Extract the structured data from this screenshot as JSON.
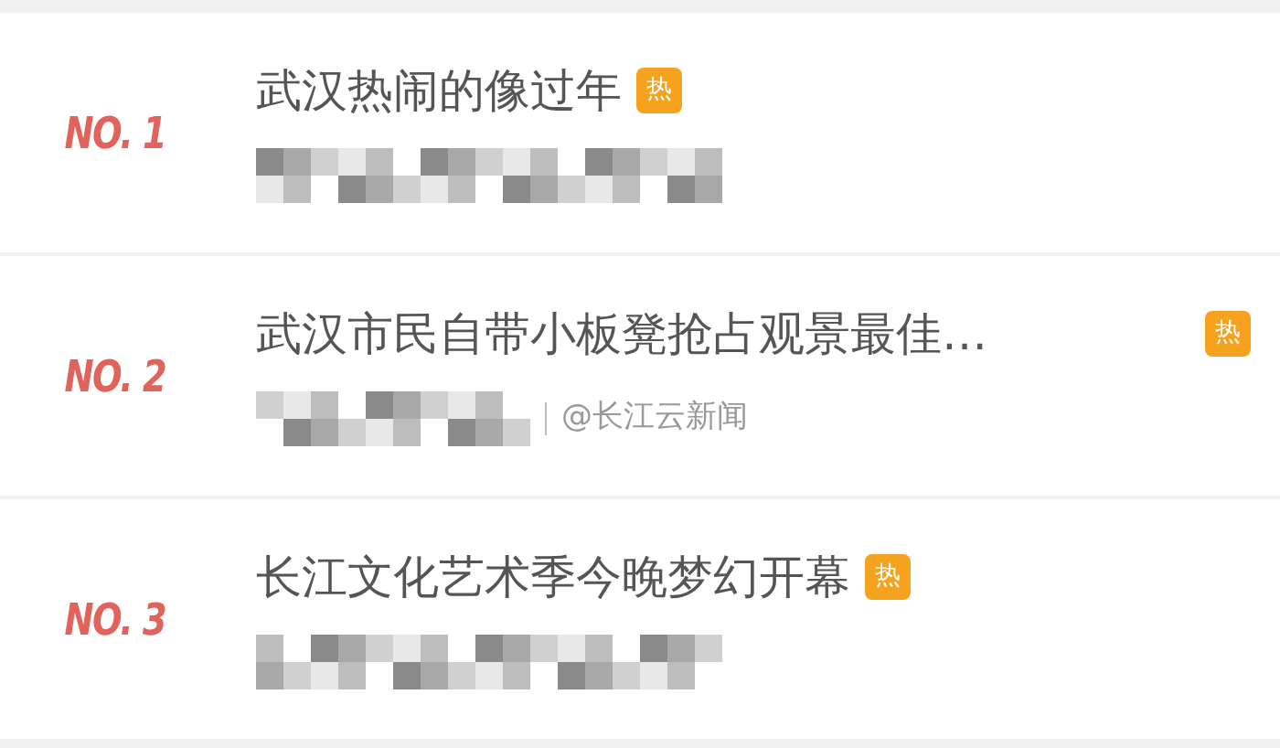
{
  "items": [
    {
      "rank": "NO. 1",
      "title": "武汉热闹的像过年",
      "hot_badge": "热"
    },
    {
      "rank": "NO. 2",
      "title": "武汉市民自带小板凳抢占观景最佳…",
      "hot_badge": "热",
      "source": "@长江云新闻"
    },
    {
      "rank": "NO. 3",
      "title": "长江文化艺术季今晚梦幻开幕",
      "hot_badge": "热"
    }
  ]
}
